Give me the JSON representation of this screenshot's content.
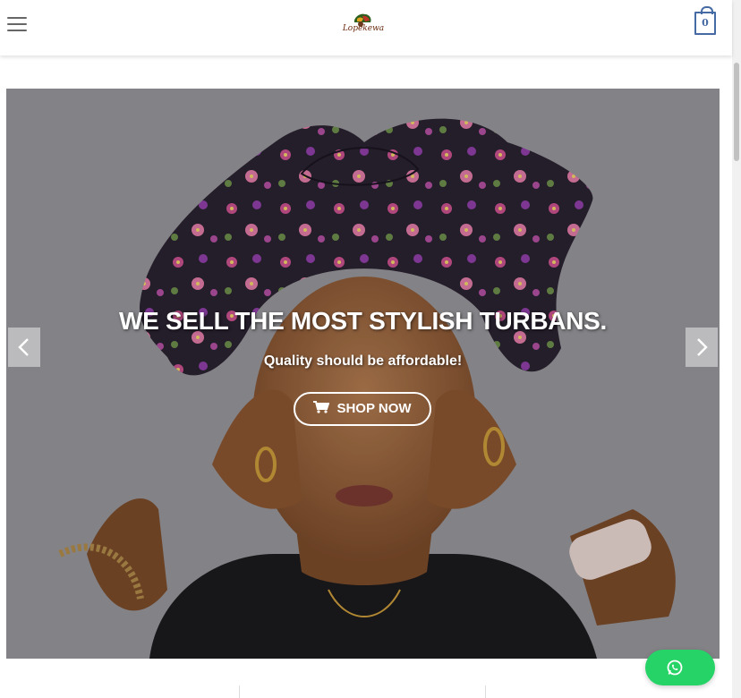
{
  "header": {
    "menu_icon": "hamburger-menu-icon",
    "logo_text": "Lopekewa",
    "cart_count": "0",
    "cart_icon": "shopping-bag-icon",
    "accent_color": "#466aa3"
  },
  "hero": {
    "headline": "WE SELL THE MOST STYLISH TURBANS.",
    "subheadline": "Quality should be affordable!",
    "cta_label": "SHOP NOW",
    "cta_icon": "shopping-cart-icon",
    "prev_icon": "chevron-left-icon",
    "next_icon": "chevron-right-icon"
  },
  "floating": {
    "whatsapp_icon": "whatsapp-icon",
    "whatsapp_color": "#25d366"
  }
}
